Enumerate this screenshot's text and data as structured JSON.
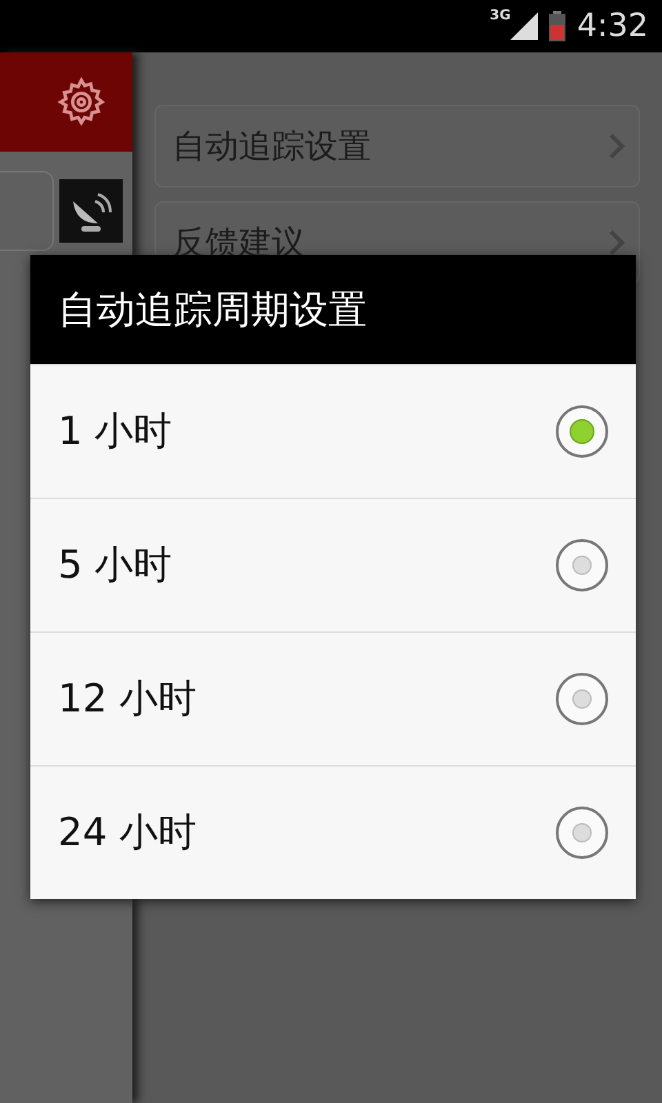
{
  "status_bar": {
    "network": "3G",
    "time": "4:32"
  },
  "settings_list": [
    {
      "label": "自动追踪设置"
    },
    {
      "label": "反馈建议"
    }
  ],
  "dialog": {
    "title": "自动追踪周期设置",
    "options": [
      {
        "label": "1 小时",
        "selected": true
      },
      {
        "label": "5 小时",
        "selected": false
      },
      {
        "label": "12 小时",
        "selected": false
      },
      {
        "label": "24 小时",
        "selected": false
      }
    ]
  }
}
